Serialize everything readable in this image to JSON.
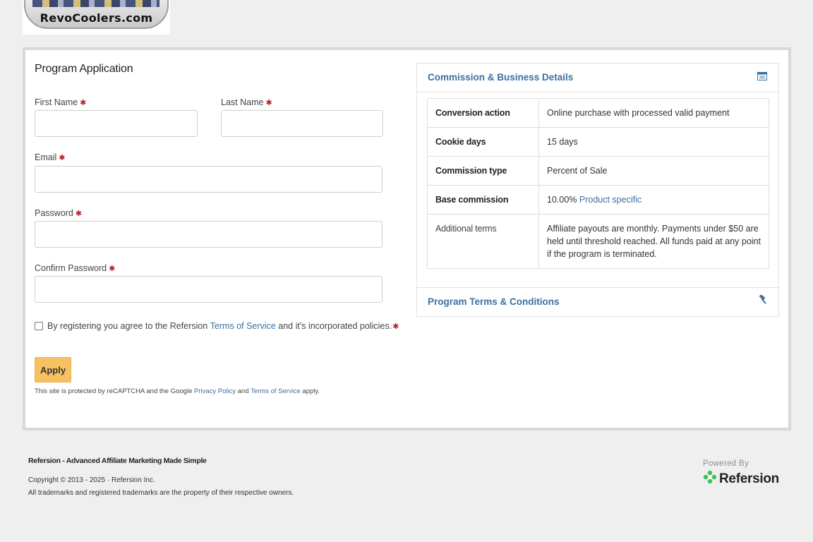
{
  "logo": {
    "text": "RevoCoolers.com"
  },
  "form": {
    "title": "Program Application",
    "first_name_label": "First Name",
    "last_name_label": "Last Name",
    "email_label": "Email",
    "password_label": "Password",
    "confirm_password_label": "Confirm Password",
    "required_mark": "✱",
    "first_name_value": "",
    "last_name_value": "",
    "email_value": "",
    "password_value": "",
    "confirm_password_value": "",
    "agree_prefix": "By registering you agree to the Refersion ",
    "agree_link": "Terms of Service",
    "agree_suffix": " and it's incorporated policies.",
    "apply_label": "Apply",
    "captcha_prefix": "This site is protected by reCAPTCHA and the Google ",
    "captcha_privacy_link": "Privacy Policy",
    "captcha_and": " and ",
    "captcha_terms_link": "Terms of Service",
    "captcha_suffix": " apply."
  },
  "commission_panel": {
    "title": "Commission & Business Details",
    "icon": "calendar-icon",
    "rows": [
      {
        "key": "Conversion action",
        "value": "Online purchase with processed valid payment"
      },
      {
        "key": "Cookie days",
        "value": "15 days"
      },
      {
        "key": "Commission type",
        "value": "Percent of Sale"
      },
      {
        "key": "Base commission",
        "value": "10.00% ",
        "link": "Product specific"
      },
      {
        "key": "Additional terms",
        "value": "Affiliate payouts are monthly. Payments under $50 are held until threshold reached. All funds paid at any point if the program is terminated."
      }
    ]
  },
  "terms_panel": {
    "title": "Program Terms & Conditions",
    "icon": "gavel-icon"
  },
  "footer": {
    "title": "Refersion - Advanced Affiliate Marketing Made Simple",
    "copyright": "Copyright © 2013 - 2025 · Refersion Inc.",
    "trademarks": "All trademarks and registered trademarks are the property of their respective owners.",
    "powered_by": "Powered By",
    "brand": "Refersion"
  },
  "colors": {
    "link": "#3b6fa0",
    "apply_button": "#f5c163",
    "required": "#b3202a",
    "brand_green": "#3cc45a"
  }
}
